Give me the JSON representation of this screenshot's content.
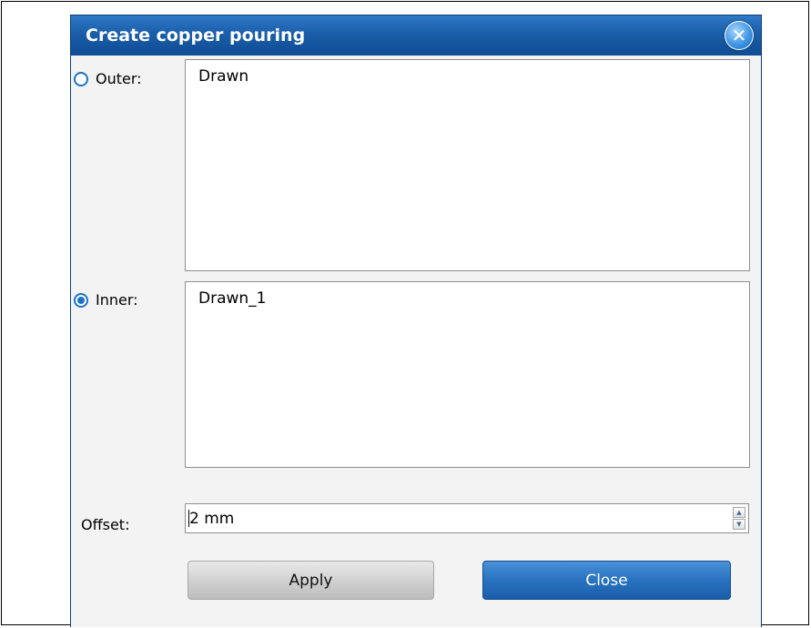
{
  "dialog": {
    "title": "Create copper pouring",
    "close_glyph": "✕"
  },
  "outer": {
    "label": "Outer:",
    "selected": false,
    "items": [
      "Drawn"
    ]
  },
  "inner": {
    "label": "Inner:",
    "selected": true,
    "items": [
      "Drawn_1"
    ]
  },
  "offset": {
    "label": "Offset:",
    "value": "2 mm"
  },
  "buttons": {
    "apply_label": "Apply",
    "close_label": "Close"
  },
  "colors": {
    "title_bar": "#1b5ea9",
    "accent": "#1a73c9"
  },
  "icons": {
    "spin_up": "▲",
    "spin_down": "▼"
  }
}
